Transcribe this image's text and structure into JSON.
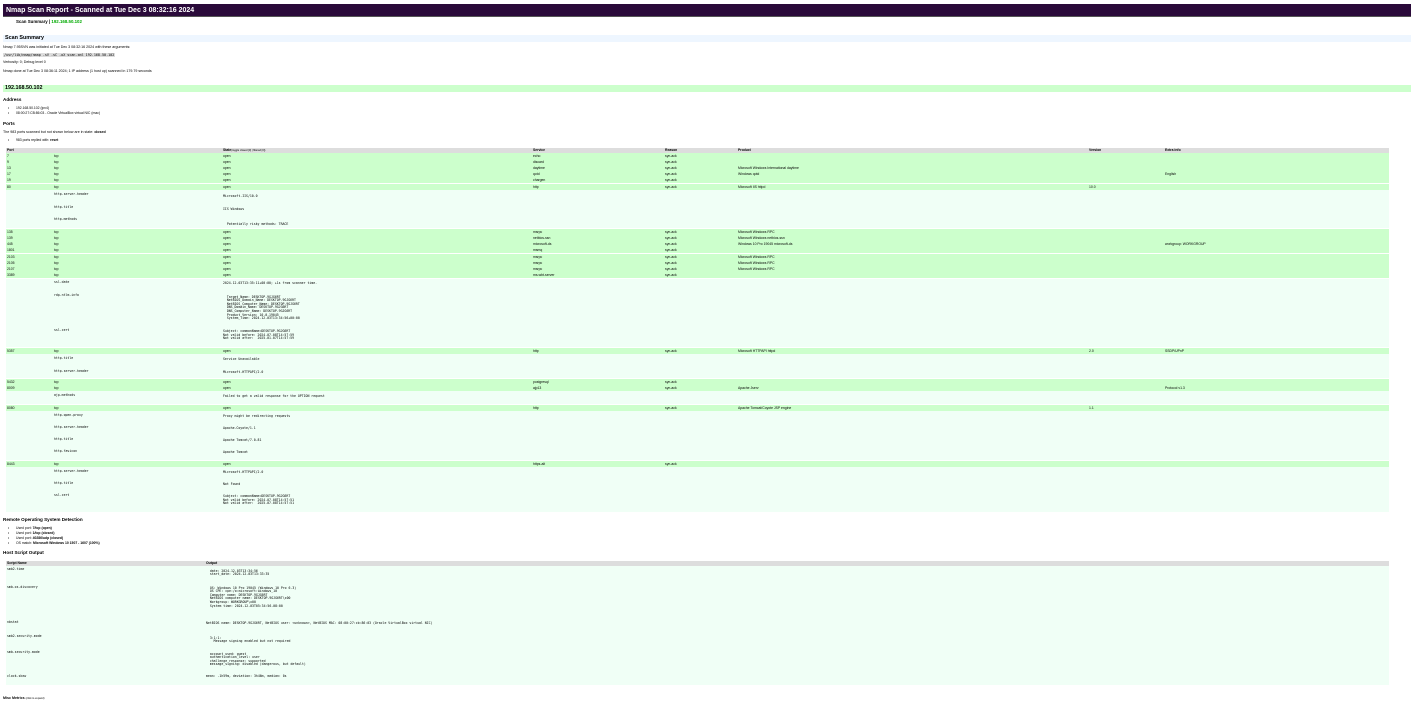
{
  "report": {
    "title": "Nmap Scan Report - Scanned at Tue Dec 3 08:32:16 2024",
    "summary_label": "Scan Summary | ",
    "summary_ip": "192.168.50.102"
  },
  "scan_summary": {
    "heading": "Scan Summary",
    "line1": "Nmap 7.95SVN was initiated at Tue Dec 3 08:32:16 2024 with these arguments:",
    "command": "/usr/lib/nmap/nmap -sV -sC -oX scan.xml 192.168.50.102",
    "verbosity": "Verbosity: 0; Debug level 0",
    "done": "Nmap done at Tue Dec 3 08:36:11 2024; 1 IP address (1 host up) scanned in 179.79 seconds"
  },
  "host": {
    "ip": "192.168.50.102",
    "address_heading": "Address",
    "addresses": [
      "192.168.50.102 (ipv4)",
      "08:00:27:CB:86:03 - Oracle VirtualBox virtual NIC (mac)"
    ],
    "ports_heading": "Ports",
    "ports_note_prefix": "The 983 ports scanned but not shown below are in state: ",
    "ports_note_state": "closed",
    "ports_bullet_prefix": "983 ports replied with: ",
    "ports_bullet_reason": "reset"
  },
  "ports_table": {
    "headers": {
      "port": "Port",
      "protocol": "",
      "state": "State",
      "state_toggle": "(toggle closed [0] | filtered [0])",
      "service": "Service",
      "reason": "Reason",
      "product": "Product",
      "version": "Version",
      "extra": "Extra info"
    },
    "rows": [
      {
        "port": "7",
        "protocol": "tcp",
        "state": "open",
        "service": "echo",
        "reason": "syn-ack",
        "product": "",
        "version": "",
        "extra": ""
      },
      {
        "port": "9",
        "protocol": "tcp",
        "state": "open",
        "service": "discard",
        "reason": "syn-ack",
        "product": "",
        "version": "",
        "extra": ""
      },
      {
        "port": "13",
        "protocol": "tcp",
        "state": "open",
        "service": "daytime",
        "reason": "syn-ack",
        "product": "Microsoft Windows International daytime",
        "version": "",
        "extra": ""
      },
      {
        "port": "17",
        "protocol": "tcp",
        "state": "open",
        "service": "qotd",
        "reason": "syn-ack",
        "product": "Windows qotd",
        "version": "",
        "extra": "English"
      },
      {
        "port": "19",
        "protocol": "tcp",
        "state": "open",
        "service": "chargen",
        "reason": "syn-ack",
        "product": "",
        "version": "",
        "extra": ""
      },
      {
        "port": "80",
        "protocol": "tcp",
        "state": "open",
        "service": "http",
        "reason": "syn-ack",
        "product": "Microsoft IIS httpd",
        "version": "10.0",
        "extra": ""
      },
      {
        "port": "135",
        "protocol": "tcp",
        "state": "open",
        "service": "msrpc",
        "reason": "syn-ack",
        "product": "Microsoft Windows RPC",
        "version": "",
        "extra": ""
      },
      {
        "port": "139",
        "protocol": "tcp",
        "state": "open",
        "service": "netbios-ssn",
        "reason": "syn-ack",
        "product": "Microsoft Windows netbios-ssn",
        "version": "",
        "extra": ""
      },
      {
        "port": "445",
        "protocol": "tcp",
        "state": "open",
        "service": "microsoft-ds",
        "reason": "syn-ack",
        "product": "Windows 10 Pro 19045 microsoft-ds",
        "version": "",
        "extra": "workgroup: WORKGROUP"
      },
      {
        "port": "1801",
        "protocol": "tcp",
        "state": "open",
        "service": "msmq",
        "reason": "syn-ack",
        "product": "",
        "version": "",
        "extra": ""
      },
      {
        "port": "2103",
        "protocol": "tcp",
        "state": "open",
        "service": "msrpc",
        "reason": "syn-ack",
        "product": "Microsoft Windows RPC",
        "version": "",
        "extra": ""
      },
      {
        "port": "2105",
        "protocol": "tcp",
        "state": "open",
        "service": "msrpc",
        "reason": "syn-ack",
        "product": "Microsoft Windows RPC",
        "version": "",
        "extra": ""
      },
      {
        "port": "2107",
        "protocol": "tcp",
        "state": "open",
        "service": "msrpc",
        "reason": "syn-ack",
        "product": "Microsoft Windows RPC",
        "version": "",
        "extra": ""
      },
      {
        "port": "3389",
        "protocol": "tcp",
        "state": "open",
        "service": "ms-wbt-server",
        "reason": "syn-ack",
        "product": "",
        "version": "",
        "extra": ""
      },
      {
        "port": "5357",
        "protocol": "tcp",
        "state": "open",
        "service": "http",
        "reason": "syn-ack",
        "product": "Microsoft HTTPAPI httpd",
        "version": "2.0",
        "extra": "SSDP/UPnP"
      },
      {
        "port": "5432",
        "protocol": "tcp",
        "state": "open",
        "service": "postgresql",
        "reason": "syn-ack",
        "product": "",
        "version": "",
        "extra": ""
      },
      {
        "port": "8009",
        "protocol": "tcp",
        "state": "open",
        "service": "ajp13",
        "reason": "syn-ack",
        "product": "Apache Jserv",
        "version": "",
        "extra": "Protocol v1.3"
      },
      {
        "port": "8080",
        "protocol": "tcp",
        "state": "open",
        "service": "http",
        "reason": "syn-ack",
        "product": "Apache Tomcat/Coyote JSP engine",
        "version": "1.1",
        "extra": ""
      },
      {
        "port": "8443",
        "protocol": "tcp",
        "state": "open",
        "service": "https-alt",
        "reason": "syn-ack",
        "product": "",
        "version": "",
        "extra": ""
      }
    ],
    "scripts": {
      "p80": [
        {
          "id": "http-server-header",
          "output": "Microsoft-IIS/10.0"
        },
        {
          "id": "http-title",
          "output": "IIS Windows"
        },
        {
          "id": "http-methods",
          "output": "\n  Potentially risky methods: TRACE"
        }
      ],
      "p3389": [
        {
          "id": "ssl-date",
          "output": "2024-12-03T13:35:11+00:00; +1s from scanner time."
        },
        {
          "id": "rdp-ntlm-info",
          "output": "\n  Target_Name: DESKTOP-9GJG6RT\n  NetBIOS_Domain_Name: DESKTOP-9GJG6RT\n  NetBIOS_Computer_Name: DESKTOP-9GJG6RT\n  DNS_Domain_Name: DESKTOP-9GJG6RT\n  DNS_Computer_Name: DESKTOP-9GJG6RT\n  Product_Version: 10.0.19045\n  System_Time: 2024-12-03T13:34:56+00:00"
        },
        {
          "id": "ssl-cert",
          "output": "Subject: commonName=DESKTOP-9GJG6RT\nNot valid before: 2024-07-08T14:57:59\nNot valid after:  2025-01-07T14:57:59"
        }
      ],
      "p5357": [
        {
          "id": "http-title",
          "output": "Service Unavailable"
        },
        {
          "id": "http-server-header",
          "output": "Microsoft-HTTPAPI/2.0"
        }
      ],
      "p8009": [
        {
          "id": "ajp-methods",
          "output": "Failed to get a valid response for the OPTION request"
        }
      ],
      "p8080": [
        {
          "id": "http-open-proxy",
          "output": "Proxy might be redirecting requests"
        },
        {
          "id": "http-server-header",
          "output": "Apache-Coyote/1.1"
        },
        {
          "id": "http-title",
          "output": "Apache Tomcat/7.0.81"
        },
        {
          "id": "http-favicon",
          "output": "Apache Tomcat"
        }
      ],
      "p8443": [
        {
          "id": "http-server-header",
          "output": "Microsoft-HTTPAPI/2.0"
        },
        {
          "id": "http-title",
          "output": "Not Found"
        },
        {
          "id": "ssl-cert",
          "output": "Subject: commonName=DESKTOP-9GJG6RT\nNot valid before: 2024-07-08T14:57:51\nNot valid after:  2025-07-08T14:57:51"
        }
      ]
    }
  },
  "os_detection": {
    "heading": "Remote Operating System Detection",
    "items": [
      {
        "prefix": "Used port: ",
        "value": "7/tcp (open)"
      },
      {
        "prefix": "Used port: ",
        "value": "1/tcp (closed)"
      },
      {
        "prefix": "Used port: ",
        "value": "40286/udp (closed)"
      },
      {
        "prefix": "OS match: ",
        "value": "Microsoft Windows 10 1507 - 1607 (100%)"
      }
    ]
  },
  "host_script": {
    "heading": "Host Script Output",
    "headers": {
      "name": "Script Name",
      "output": "Output"
    },
    "rows": [
      {
        "name": "smb2-time",
        "output": "\n  date: 2024-12-03T13:34:56\n  start_date: 2024-12-03T13:33:35"
      },
      {
        "name": "smb-os-discovery",
        "output": "\n  OS: Windows 10 Pro 19045 (Windows 10 Pro 6.3)\n  OS CPE: cpe:/o:microsoft:windows_10\n  Computer name: DESKTOP-9GJG6RT\n  NetBIOS computer name: DESKTOP-9GJG6RT\\x00\n  Workgroup: WORKGROUP\\x00\n  System time: 2024-12-03T05:34:56-08:00"
      },
      {
        "name": "nbstat",
        "output": "NetBIOS name: DESKTOP-9GJG6RT, NetBIOS user: <unknown>, NetBIOS MAC: 08:00:27:cb:86:03 (Oracle VirtualBox virtual NIC)"
      },
      {
        "name": "smb2-security-mode",
        "output": "\n  3:1:1:\n    Message signing enabled but not required"
      },
      {
        "name": "smb-security-mode",
        "output": "\n  account_used: guest\n  authentication_level: user\n  challenge_response: supported\n  message_signing: disabled (dangerous, but default)"
      },
      {
        "name": "clock-skew",
        "output": "mean: -1h59m, deviation: 3h46m, median: 0s"
      }
    ]
  },
  "misc": {
    "label": "Misc Metrics",
    "toggle": "(click to expand)"
  }
}
